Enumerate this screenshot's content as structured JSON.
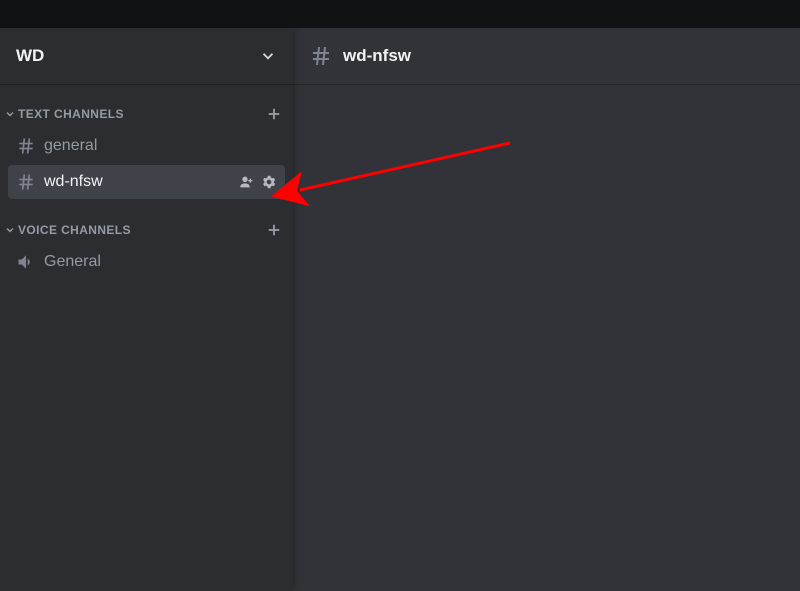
{
  "server": {
    "name": "WD"
  },
  "main_channel": {
    "name": "wd-nfsw"
  },
  "categories": [
    {
      "label": "TEXT CHANNELS",
      "channels": [
        {
          "name": "general"
        },
        {
          "name": "wd-nfsw"
        }
      ]
    },
    {
      "label": "VOICE CHANNELS",
      "channels": [
        {
          "name": "General"
        }
      ]
    }
  ],
  "colors": {
    "arrow": "#ff0000"
  }
}
